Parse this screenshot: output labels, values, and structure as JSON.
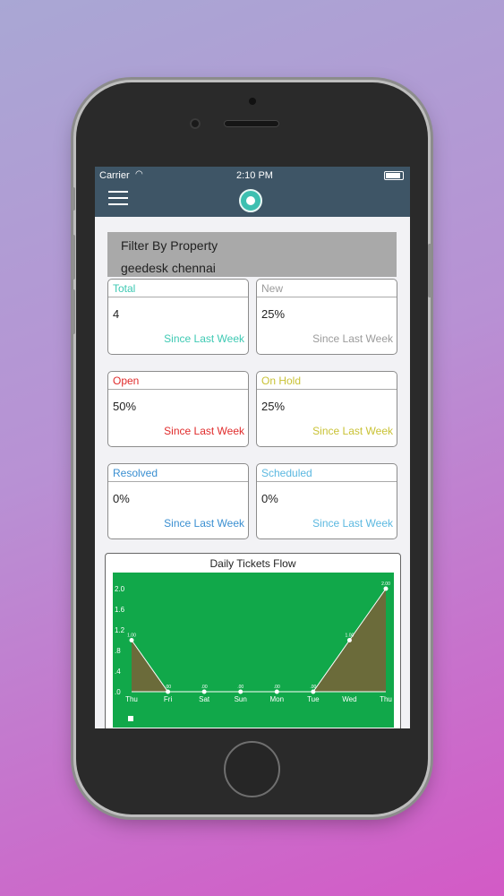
{
  "status_bar": {
    "carrier": "Carrier",
    "time": "2:10 PM"
  },
  "filter": {
    "title": "Filter By Property",
    "value": "geedesk chennai"
  },
  "cards": [
    {
      "title": "Total",
      "value": "4",
      "since": "Since Last Week",
      "color": "#3ec9b3"
    },
    {
      "title": "New",
      "value": "25%",
      "since": "Since Last Week",
      "color": "#9b9b9b"
    },
    {
      "title": "Open",
      "value": "50%",
      "since": "Since Last Week",
      "color": "#e02b2b"
    },
    {
      "title": "On Hold",
      "value": "25%",
      "since": "Since Last Week",
      "color": "#c9c235"
    },
    {
      "title": "Resolved",
      "value": "0%",
      "since": "Since Last Week",
      "color": "#3a8fd1"
    },
    {
      "title": "Scheduled",
      "value": "0%",
      "since": "Since Last Week",
      "color": "#5bb8e0"
    }
  ],
  "chart_data": {
    "type": "area",
    "title": "Daily Tickets Flow",
    "categories": [
      "Thu",
      "Fri",
      "Sat",
      "Sun",
      "Mon",
      "Tue",
      "Wed",
      "Thu"
    ],
    "series": [
      {
        "values": [
          1.0,
          0,
          0,
          0,
          0,
          0,
          1.0,
          2.0
        ],
        "color": "#6b6b3a"
      }
    ],
    "data_labels": [
      "1.00",
      ".00",
      ".00",
      ".00",
      ".00",
      ".00",
      "1.00",
      "2.00"
    ],
    "y_ticks": [
      "2.0",
      "1.6",
      "1.2",
      ".8",
      ".4",
      ".0"
    ],
    "ylim": [
      0,
      2.0
    ],
    "background": "#11a84a",
    "grid": false
  }
}
